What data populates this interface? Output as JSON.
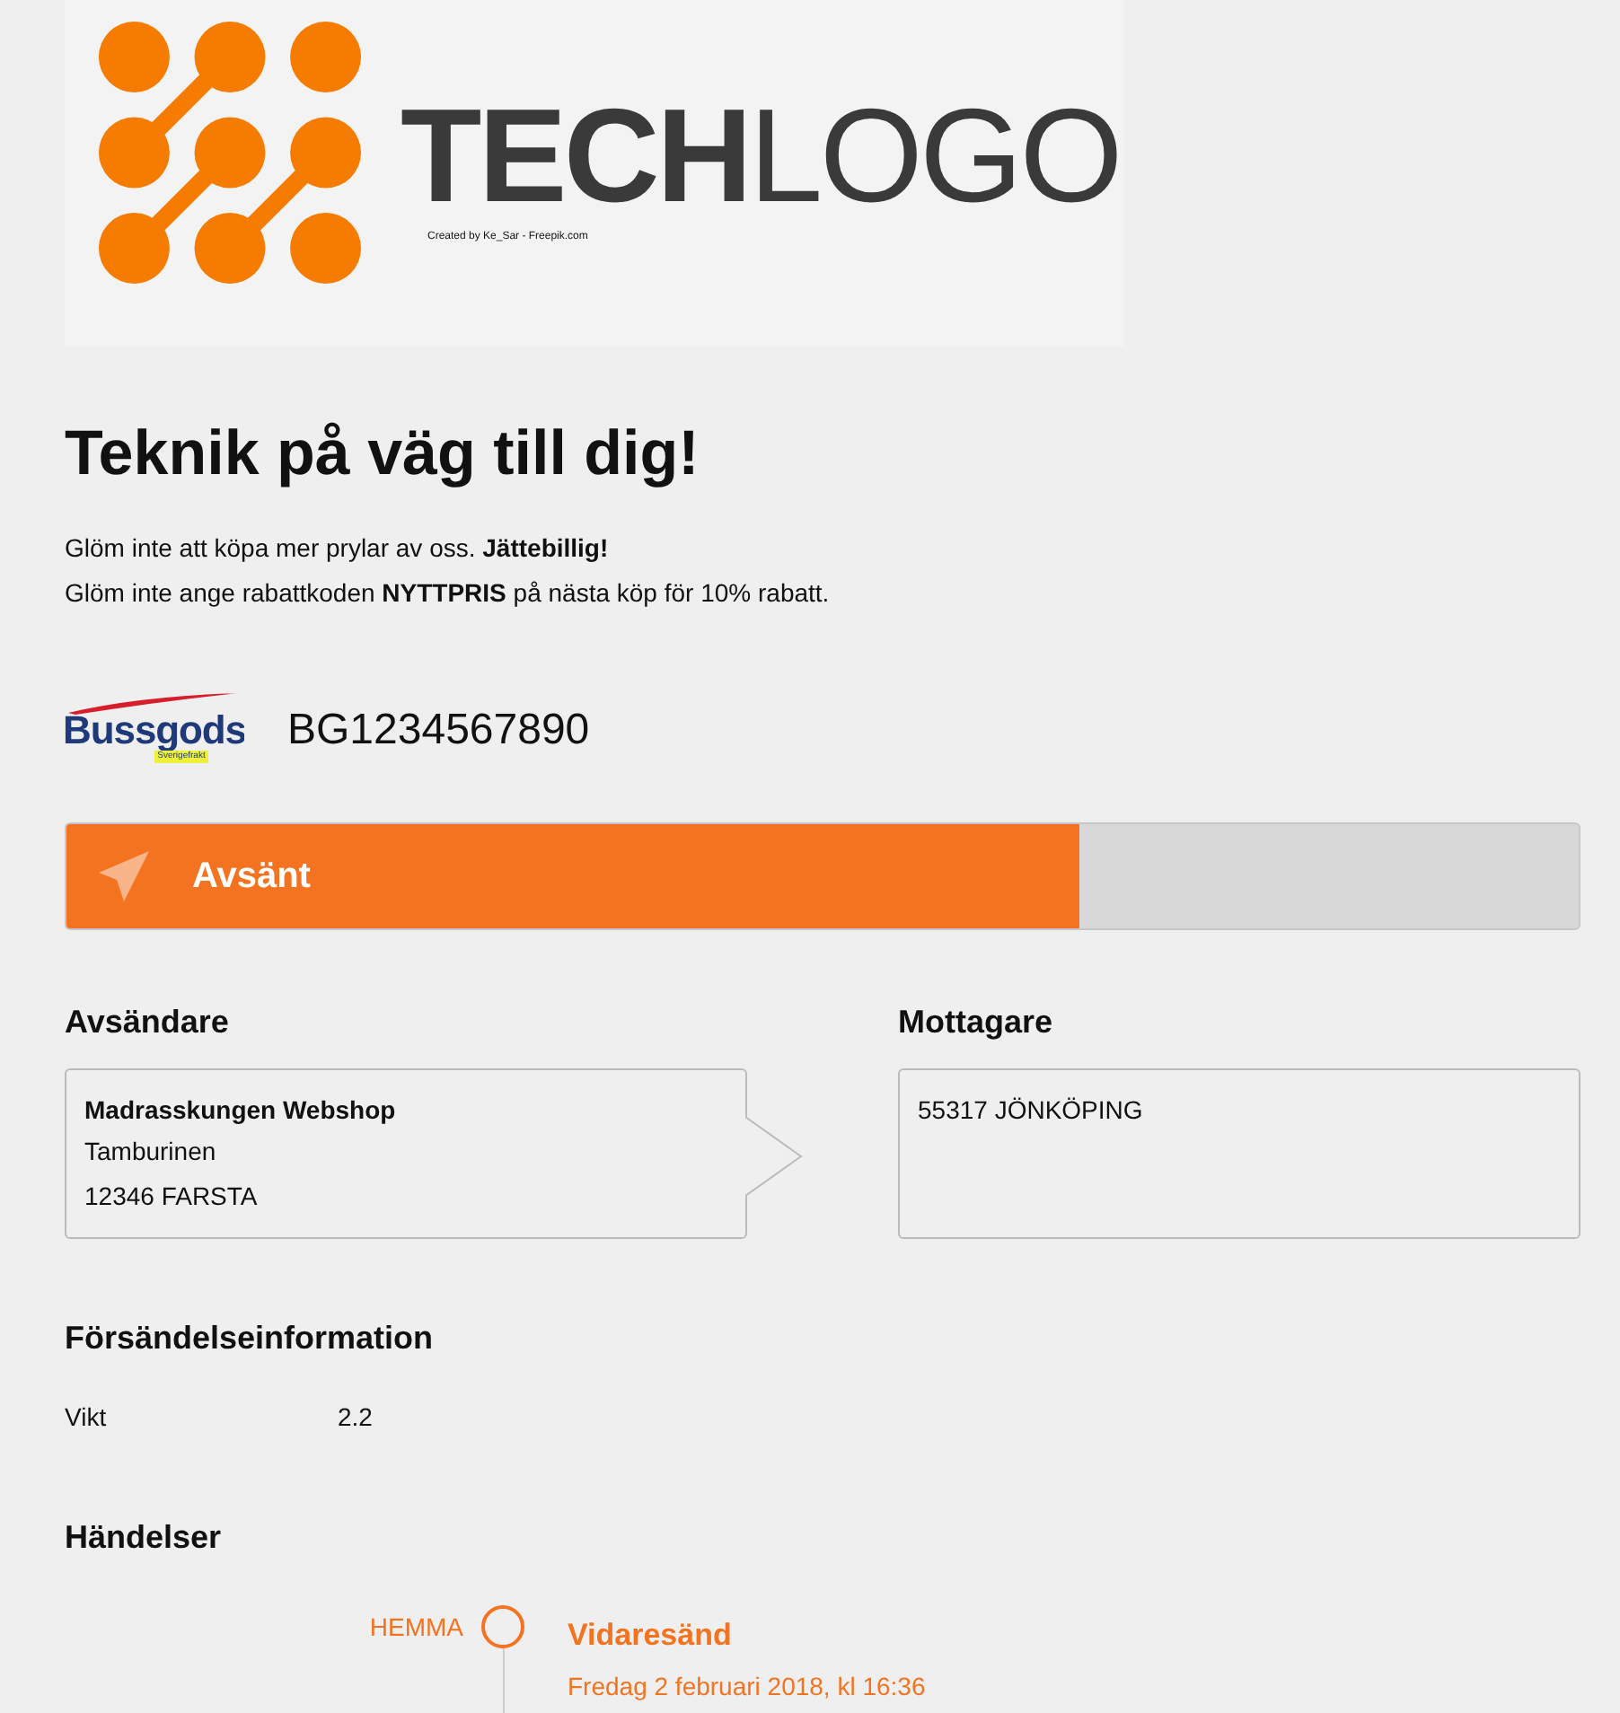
{
  "logo": {
    "word_bold": "TECH",
    "word_light": "LOGO",
    "credit": "Created by Ke_Sar - Freepik.com"
  },
  "heading": "Teknik på väg till dig!",
  "intro": [
    "Glöm inte att köpa mer prylar av oss. **Jättebillig!**",
    "Glöm inte ange rabattkoden **NYTTPRIS** på nästa köp för 10% rabatt."
  ],
  "carrier": {
    "name": "Bussgods",
    "tagline": "Sverigefrakt",
    "tracking_number": "BG1234567890"
  },
  "progress": {
    "label": "Avsänt",
    "level": 0.67
  },
  "sender": {
    "title": "Avsändare",
    "name": "Madrasskungen Webshop",
    "lines": [
      "Tamburinen",
      "12346 FARSTA"
    ]
  },
  "recipient": {
    "title": "Mottagare",
    "lines": [
      "55317 JÖNKÖPING"
    ]
  },
  "shipment": {
    "title": "Försändelseinformation",
    "rows": [
      {
        "label": "Vikt",
        "value": "2.2"
      }
    ]
  },
  "events": {
    "title": "Händelser",
    "items": [
      {
        "place": "HEMMA",
        "title": "Vidaresänd",
        "time": "Fredag 2 februari 2018, kl 16:36"
      }
    ]
  }
}
